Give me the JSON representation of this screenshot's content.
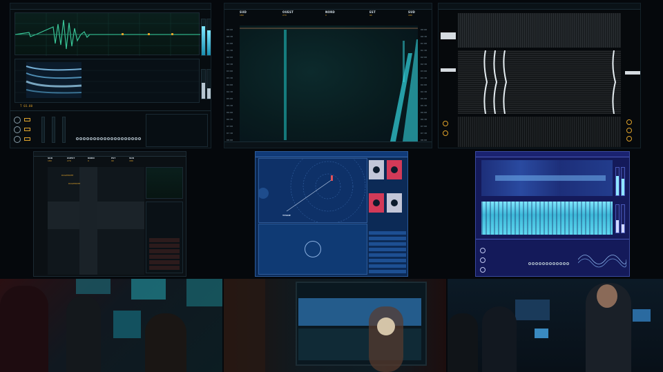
{
  "sonar_screen_1": {
    "scale_label": "T 03.00",
    "controls": [
      "",
      "",
      ""
    ]
  },
  "waterfall_screen": {
    "bearings": [
      {
        "dir": "SUD",
        "deg": "180"
      },
      {
        "dir": "OUEST",
        "deg": "270"
      },
      {
        "dir": "NORD",
        "deg": "0"
      },
      {
        "dir": "EST",
        "deg": "90"
      },
      {
        "dir": "SUD",
        "deg": "180"
      }
    ],
    "time_labels": [
      "00:00",
      "00:30",
      "01:00",
      "01:30",
      "02:00",
      "02:30",
      "03:00",
      "03:30",
      "04:00",
      "04:30",
      "05:00",
      "05:30",
      "06:00",
      "06:30",
      "07:00",
      "07:30",
      "08:00"
    ]
  },
  "noise_screen": {
    "legend_rows": [
      "",
      "",
      "",
      "",
      ""
    ]
  },
  "bearing_screen": {
    "bearings": [
      {
        "dir": "SUD",
        "deg": "180"
      },
      {
        "dir": "OUEST",
        "deg": "270"
      },
      {
        "dir": "NORD",
        "deg": "0"
      },
      {
        "dir": "EST",
        "deg": "90"
      },
      {
        "dir": "SUD",
        "deg": "180"
      }
    ],
    "tags": [
      "DOLPHINTE",
      "DOLPHINTE"
    ]
  },
  "tactical_screen": {
    "target_label": "TITANE"
  },
  "spectrum_screen": {},
  "photos": {
    "crew_1": "",
    "crew_2": "",
    "crew_3": ""
  }
}
